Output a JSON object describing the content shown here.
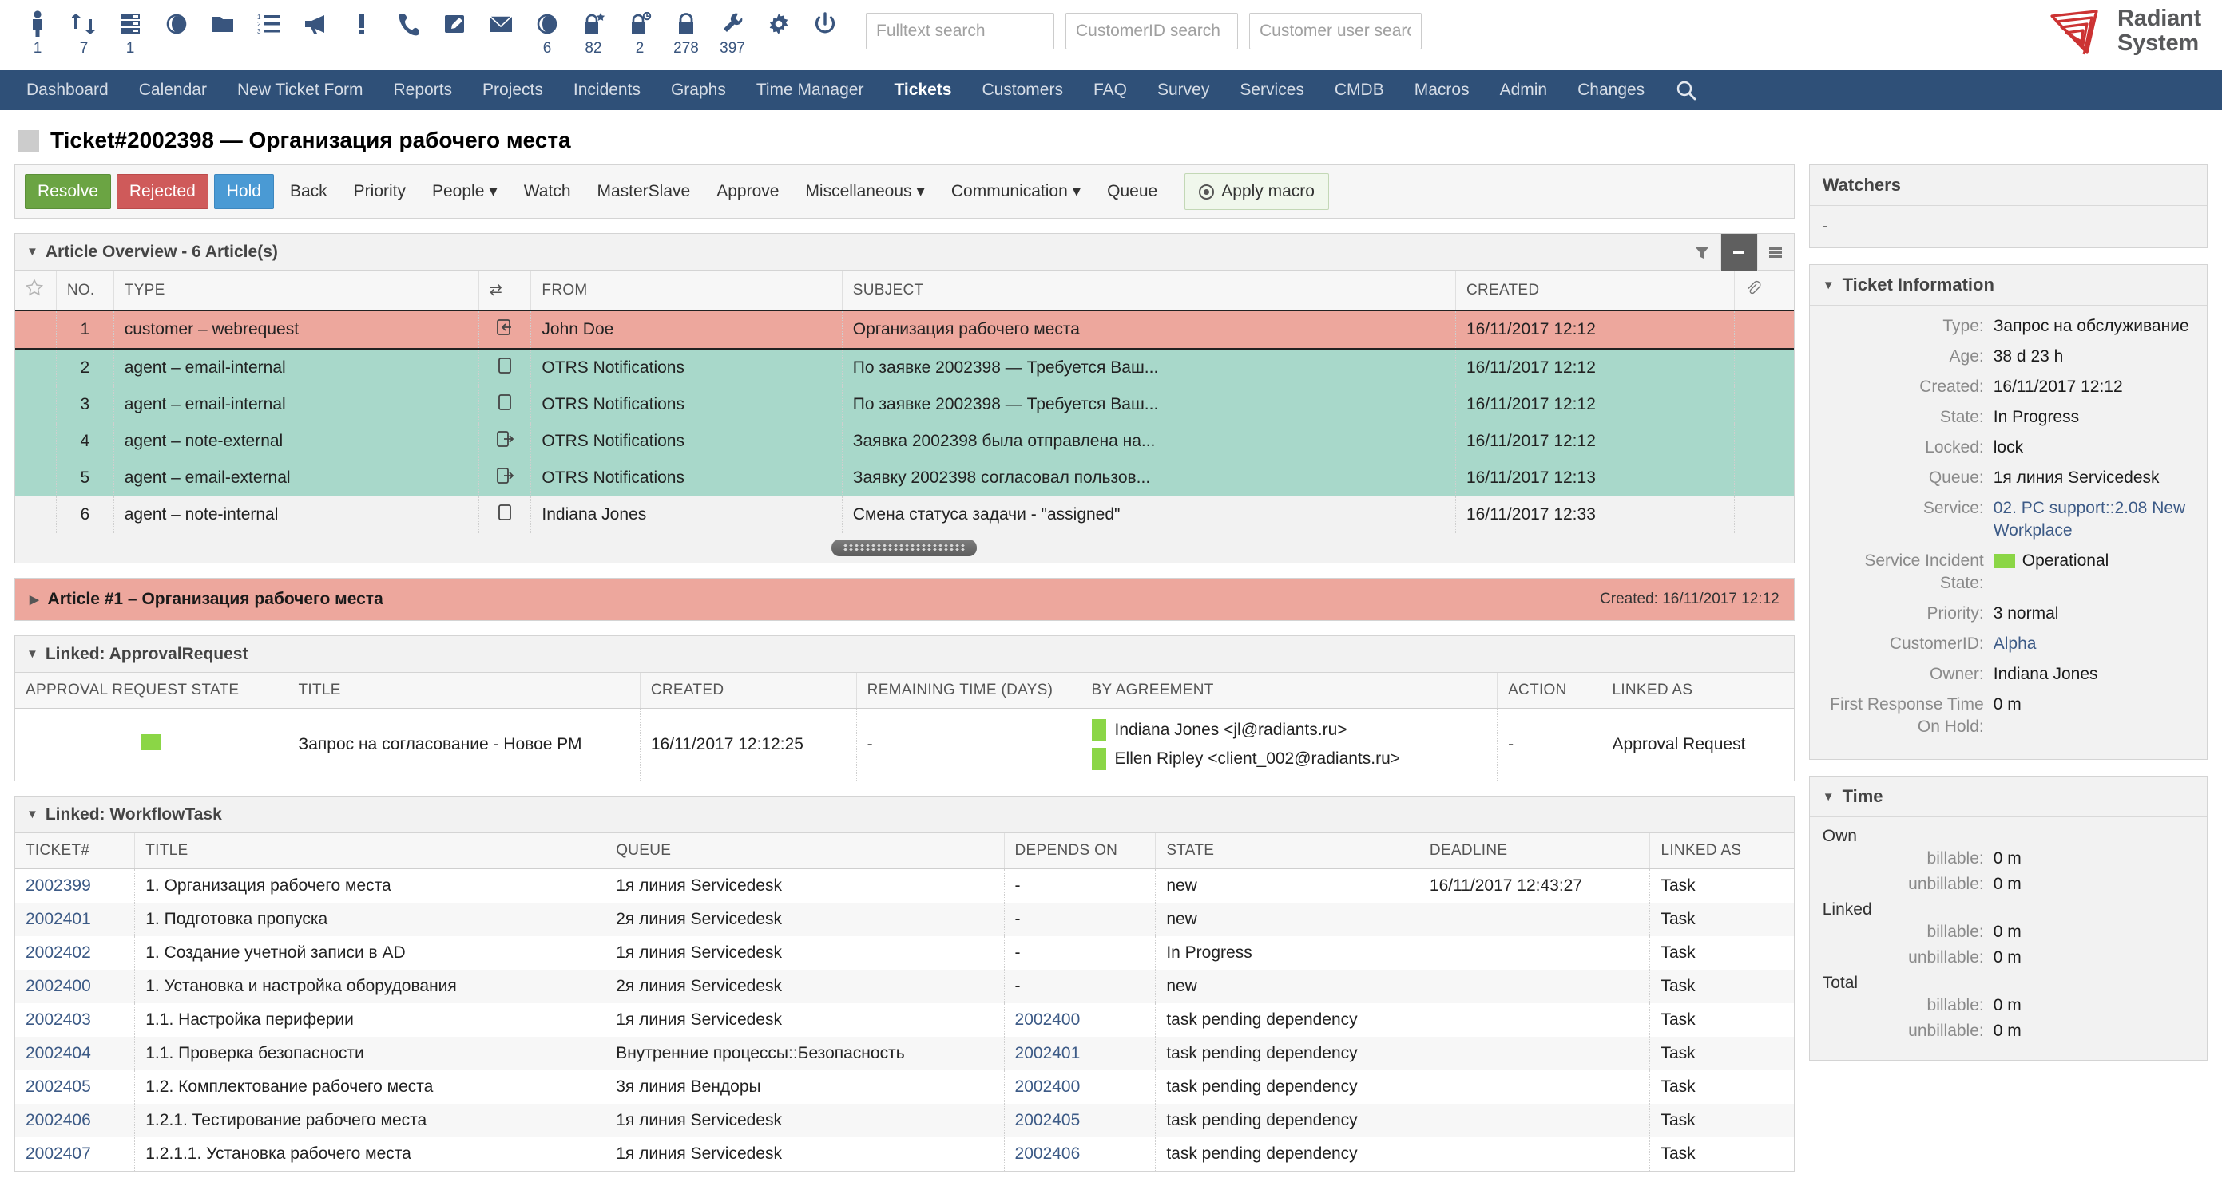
{
  "toolbar": {
    "icons": [
      {
        "name": "person-icon",
        "count": "1"
      },
      {
        "name": "refresh-ticket-icon",
        "count": "7"
      },
      {
        "name": "server-icon",
        "count": "1"
      },
      {
        "name": "eye-icon",
        "count": ""
      },
      {
        "name": "folder-icon",
        "count": ""
      },
      {
        "name": "numbered-list-icon",
        "count": ""
      },
      {
        "name": "megaphone-icon",
        "count": ""
      },
      {
        "name": "exclamation-icon",
        "count": ""
      },
      {
        "name": "phone-icon",
        "count": ""
      },
      {
        "name": "compose-icon",
        "count": ""
      },
      {
        "name": "envelope-icon",
        "count": ""
      },
      {
        "name": "eye-watched-icon",
        "count": "6"
      },
      {
        "name": "lock-star-icon",
        "count": "82"
      },
      {
        "name": "lock-clock-icon",
        "count": "2"
      },
      {
        "name": "lock-icon",
        "count": "278"
      },
      {
        "name": "wrench-icon",
        "count": "397"
      },
      {
        "name": "gear-icon",
        "count": ""
      },
      {
        "name": "power-icon",
        "count": ""
      }
    ],
    "search": {
      "fulltext_placeholder": "Fulltext search",
      "customerid_placeholder": "CustomerID search",
      "customeruser_placeholder": "Customer user search"
    },
    "brand": {
      "line1": "Radiant",
      "line2": "System",
      "color": "#cc3333"
    }
  },
  "nav": {
    "items": [
      {
        "label": "Dashboard",
        "active": false
      },
      {
        "label": "Calendar",
        "active": false
      },
      {
        "label": "New Ticket Form",
        "active": false
      },
      {
        "label": "Reports",
        "active": false
      },
      {
        "label": "Projects",
        "active": false
      },
      {
        "label": "Incidents",
        "active": false
      },
      {
        "label": "Graphs",
        "active": false
      },
      {
        "label": "Time Manager",
        "active": false
      },
      {
        "label": "Tickets",
        "active": true
      },
      {
        "label": "Customers",
        "active": false
      },
      {
        "label": "FAQ",
        "active": false
      },
      {
        "label": "Survey",
        "active": false
      },
      {
        "label": "Services",
        "active": false
      },
      {
        "label": "CMDB",
        "active": false
      },
      {
        "label": "Macros",
        "active": false
      },
      {
        "label": "Admin",
        "active": false
      },
      {
        "label": "Changes",
        "active": false
      }
    ],
    "search_icon": "search-icon"
  },
  "page": {
    "title": "Ticket#2002398 — Организация рабочего места"
  },
  "actions": {
    "resolve": "Resolve",
    "rejected": "Rejected",
    "hold": "Hold",
    "back": "Back",
    "priority": "Priority",
    "people": "People ▾",
    "watch": "Watch",
    "masterslave": "MasterSlave",
    "approve": "Approve",
    "miscellaneous": "Miscellaneous ▾",
    "communication": "Communication ▾",
    "queue": "Queue",
    "apply_macro": "Apply macro"
  },
  "article_overview": {
    "title": "Article Overview - 6 Article(s)",
    "caret": "▼",
    "head_icons": [
      "filter-icon",
      "collapse-icon",
      "menu-icon"
    ],
    "columns": [
      "",
      "NO.",
      "TYPE",
      "",
      "FROM",
      "SUBJECT",
      "CREATED",
      ""
    ],
    "rows": [
      {
        "no": "1",
        "type": "customer – webrequest",
        "dir": "inbound",
        "from": "John Doe",
        "subject": "Организация рабочего места",
        "created": "16/11/2017 12:12",
        "style": "selected"
      },
      {
        "no": "2",
        "type": "agent – email-internal",
        "dir": "internal",
        "from": "OTRS Notifications",
        "subject": "По заявке 2002398 — Требуется Ваш...",
        "created": "16/11/2017 12:12",
        "style": "green"
      },
      {
        "no": "3",
        "type": "agent – email-internal",
        "dir": "internal",
        "from": "OTRS Notifications",
        "subject": "По заявке 2002398 — Требуется Ваш...",
        "created": "16/11/2017 12:12",
        "style": "green"
      },
      {
        "no": "4",
        "type": "agent – note-external",
        "dir": "outbound",
        "from": "OTRS Notifications",
        "subject": "Заявка 2002398 была отправлена на...",
        "created": "16/11/2017 12:12",
        "style": "green"
      },
      {
        "no": "5",
        "type": "agent – email-external",
        "dir": "outbound",
        "from": "OTRS Notifications",
        "subject": "Заявку 2002398 согласовал пользов...",
        "created": "16/11/2017 12:13",
        "style": "green"
      },
      {
        "no": "6",
        "type": "agent – note-internal",
        "dir": "internal",
        "from": "Indiana Jones",
        "subject": "Смена статуса задачи - \"assigned\"",
        "created": "16/11/2017 12:33",
        "style": "plain"
      }
    ]
  },
  "article_strip": {
    "caret": "▶",
    "title": "Article #1 – Организация рабочего места",
    "created": "Created: 16/11/2017 12:12"
  },
  "approval": {
    "title": "Linked: ApprovalRequest",
    "caret": "▼",
    "columns": [
      "APPROVAL REQUEST STATE",
      "TITLE",
      "CREATED",
      "REMAINING TIME (DAYS)",
      "BY AGREEMENT",
      "ACTION",
      "LINKED AS"
    ],
    "row": {
      "state_color": "#8bd646",
      "title": "Запрос на согласование - Новое РМ",
      "created": "16/11/2017 12:12:25",
      "remaining": "-",
      "agreements": [
        "Indiana Jones <jl@radiants.ru>",
        "Ellen Ripley <client_002@radiants.ru>"
      ],
      "action": "-",
      "linked_as": "Approval Request"
    }
  },
  "workflow": {
    "title": "Linked: WorkflowTask",
    "caret": "▼",
    "columns": [
      "TICKET#",
      "TITLE",
      "QUEUE",
      "DEPENDS ON",
      "STATE",
      "DEADLINE",
      "LINKED AS"
    ],
    "rows": [
      {
        "ticket": "2002399",
        "title": "1. Организация рабочего места",
        "queue": "1я линия Servicedesk",
        "depends": "-",
        "state": "new",
        "deadline": "16/11/2017 12:43:27",
        "linked": "Task"
      },
      {
        "ticket": "2002401",
        "title": "1. Подготовка пропуска",
        "queue": "2я линия Servicedesk",
        "depends": "-",
        "state": "new",
        "deadline": "",
        "linked": "Task"
      },
      {
        "ticket": "2002402",
        "title": "1. Создание учетной записи в AD",
        "queue": "1я линия Servicedesk",
        "depends": "-",
        "state": "In Progress",
        "deadline": "",
        "linked": "Task"
      },
      {
        "ticket": "2002400",
        "title": "1. Установка и настройка оборудования",
        "queue": "2я линия Servicedesk",
        "depends": "-",
        "state": "new",
        "deadline": "",
        "linked": "Task"
      },
      {
        "ticket": "2002403",
        "title": "1.1. Настройка периферии",
        "queue": "1я линия Servicedesk",
        "depends": "2002400",
        "state": "task pending dependency",
        "deadline": "",
        "linked": "Task"
      },
      {
        "ticket": "2002404",
        "title": "1.1. Проверка безопасности",
        "queue": "Внутренние процессы::Безопасность",
        "depends": "2002401",
        "state": "task pending dependency",
        "deadline": "",
        "linked": "Task"
      },
      {
        "ticket": "2002405",
        "title": "1.2. Комплектование рабочего места",
        "queue": "3я линия Вендоры",
        "depends": "2002400",
        "state": "task pending dependency",
        "deadline": "",
        "linked": "Task"
      },
      {
        "ticket": "2002406",
        "title": "1.2.1. Тестирование рабочего места",
        "queue": "1я линия Servicedesk",
        "depends": "2002405",
        "state": "task pending dependency",
        "deadline": "",
        "linked": "Task"
      },
      {
        "ticket": "2002407",
        "title": "1.2.1.1. Установка рабочего места",
        "queue": "1я линия Servicedesk",
        "depends": "2002406",
        "state": "task pending dependency",
        "deadline": "",
        "linked": "Task"
      }
    ]
  },
  "sidebar": {
    "watchers": {
      "title": "Watchers",
      "value": "-"
    },
    "ticket_info": {
      "title": "Ticket Information",
      "caret": "▼",
      "fields": [
        {
          "key": "Type:",
          "value": "Запрос на обслуживание",
          "link": false
        },
        {
          "key": "Age:",
          "value": "38 d 23 h",
          "link": false
        },
        {
          "key": "Created:",
          "value": "16/11/2017 12:12",
          "link": false
        },
        {
          "key": "State:",
          "value": "In Progress",
          "link": false
        },
        {
          "key": "Locked:",
          "value": "lock",
          "link": false
        },
        {
          "key": "Queue:",
          "value": "1я линия Servicedesk",
          "link": false
        },
        {
          "key": "Service:",
          "value": "02. PC support::2.08 New Workplace",
          "link": true
        },
        {
          "key": "Service Incident State:",
          "value": "Operational",
          "link": false,
          "swatch": "#8bd646"
        },
        {
          "key": "Priority:",
          "value": "3 normal",
          "link": false
        },
        {
          "key": "CustomerID:",
          "value": "Alpha",
          "link": true
        },
        {
          "key": "Owner:",
          "value": "Indiana Jones",
          "link": false
        },
        {
          "key": "First Response Time On Hold:",
          "value": "0 m",
          "link": false
        }
      ]
    },
    "time": {
      "title": "Time",
      "caret": "▼",
      "groups": [
        {
          "name": "Own",
          "rows": [
            {
              "k": "billable:",
              "v": "0 m"
            },
            {
              "k": "unbillable:",
              "v": "0 m"
            }
          ]
        },
        {
          "name": "Linked",
          "rows": [
            {
              "k": "billable:",
              "v": "0 m"
            },
            {
              "k": "unbillable:",
              "v": "0 m"
            }
          ]
        },
        {
          "name": "Total",
          "rows": [
            {
              "k": "billable:",
              "v": "0 m"
            },
            {
              "k": "unbillable:",
              "v": "0 m"
            }
          ]
        }
      ]
    }
  }
}
